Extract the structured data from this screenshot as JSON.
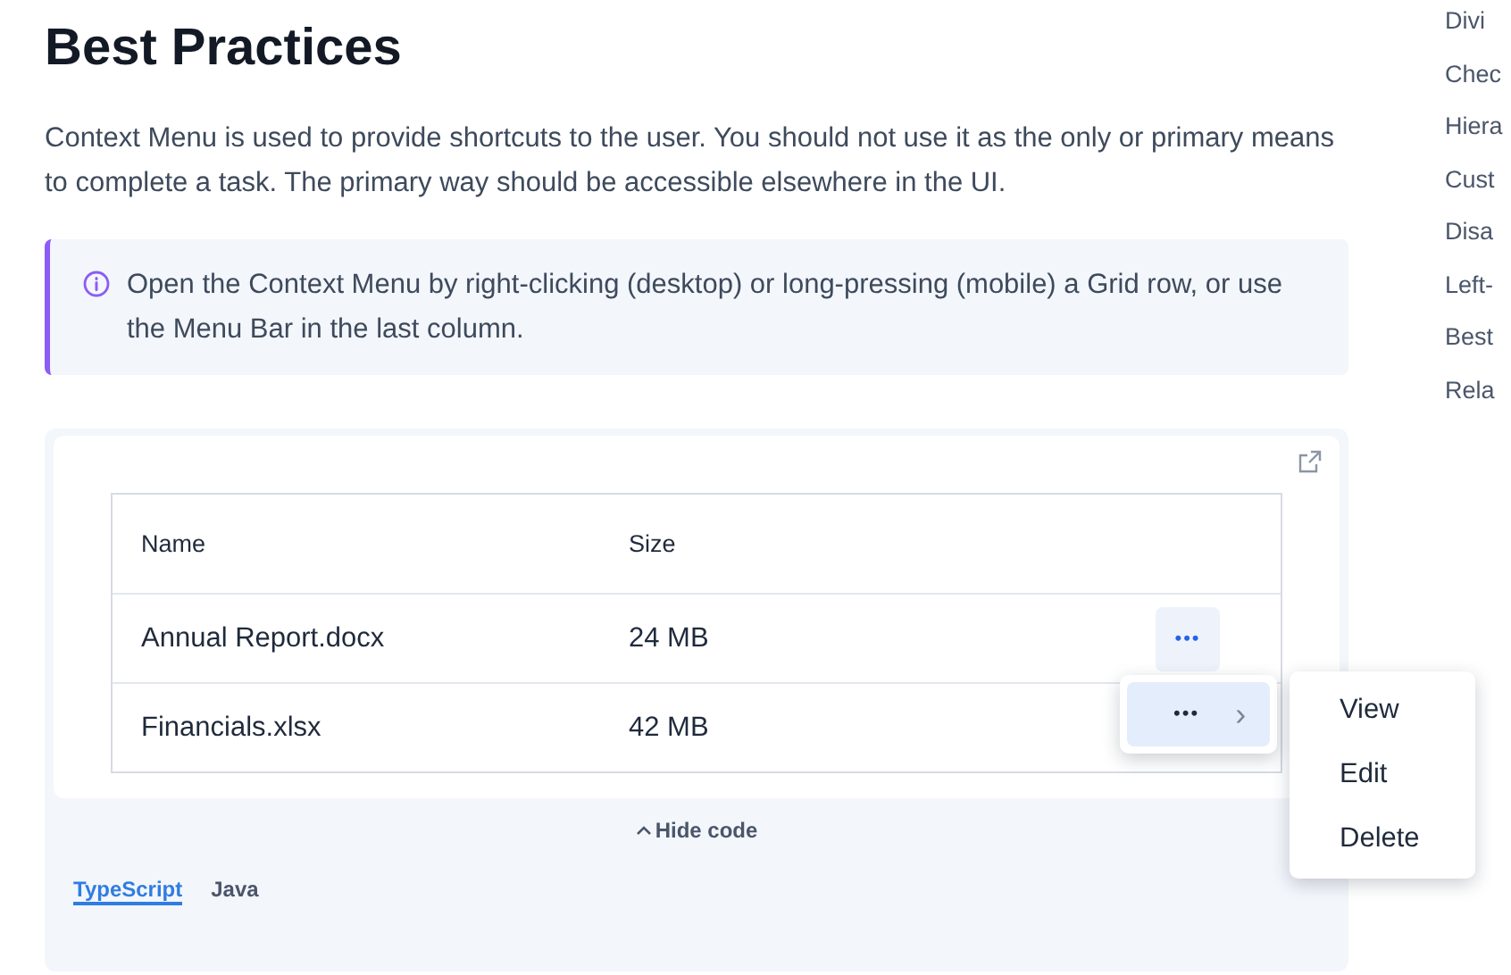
{
  "heading": "Best Practices",
  "intro": "Context Menu is used to provide shortcuts to the user. You should not use it as the only or primary means to complete a task. The primary way should be accessible elsewhere in the UI.",
  "note": "Open the Context Menu by right-clicking (desktop) or long-pressing (mobile) a Grid row, or use the Menu Bar in the last column.",
  "grid": {
    "columns": [
      "Name",
      "Size"
    ],
    "rows": [
      {
        "name": "Annual Report.docx",
        "size": "24 MB",
        "menu_button": "•••"
      },
      {
        "name": "Financials.xlsx",
        "size": "42 MB"
      }
    ]
  },
  "context_menu": {
    "item": {
      "label": "•••",
      "chevron": "›",
      "expanded": true
    },
    "submenu": [
      "View",
      "Edit",
      "Delete"
    ]
  },
  "hide_code": "Hide code",
  "code_tabs": [
    {
      "label": "TypeScript",
      "selected": true
    },
    {
      "label": "Java",
      "selected": false
    }
  ],
  "toc": [
    "Divi",
    "Chec",
    "Hiera",
    "Cust",
    "Disa",
    "Left-",
    "Best",
    "Rela"
  ]
}
